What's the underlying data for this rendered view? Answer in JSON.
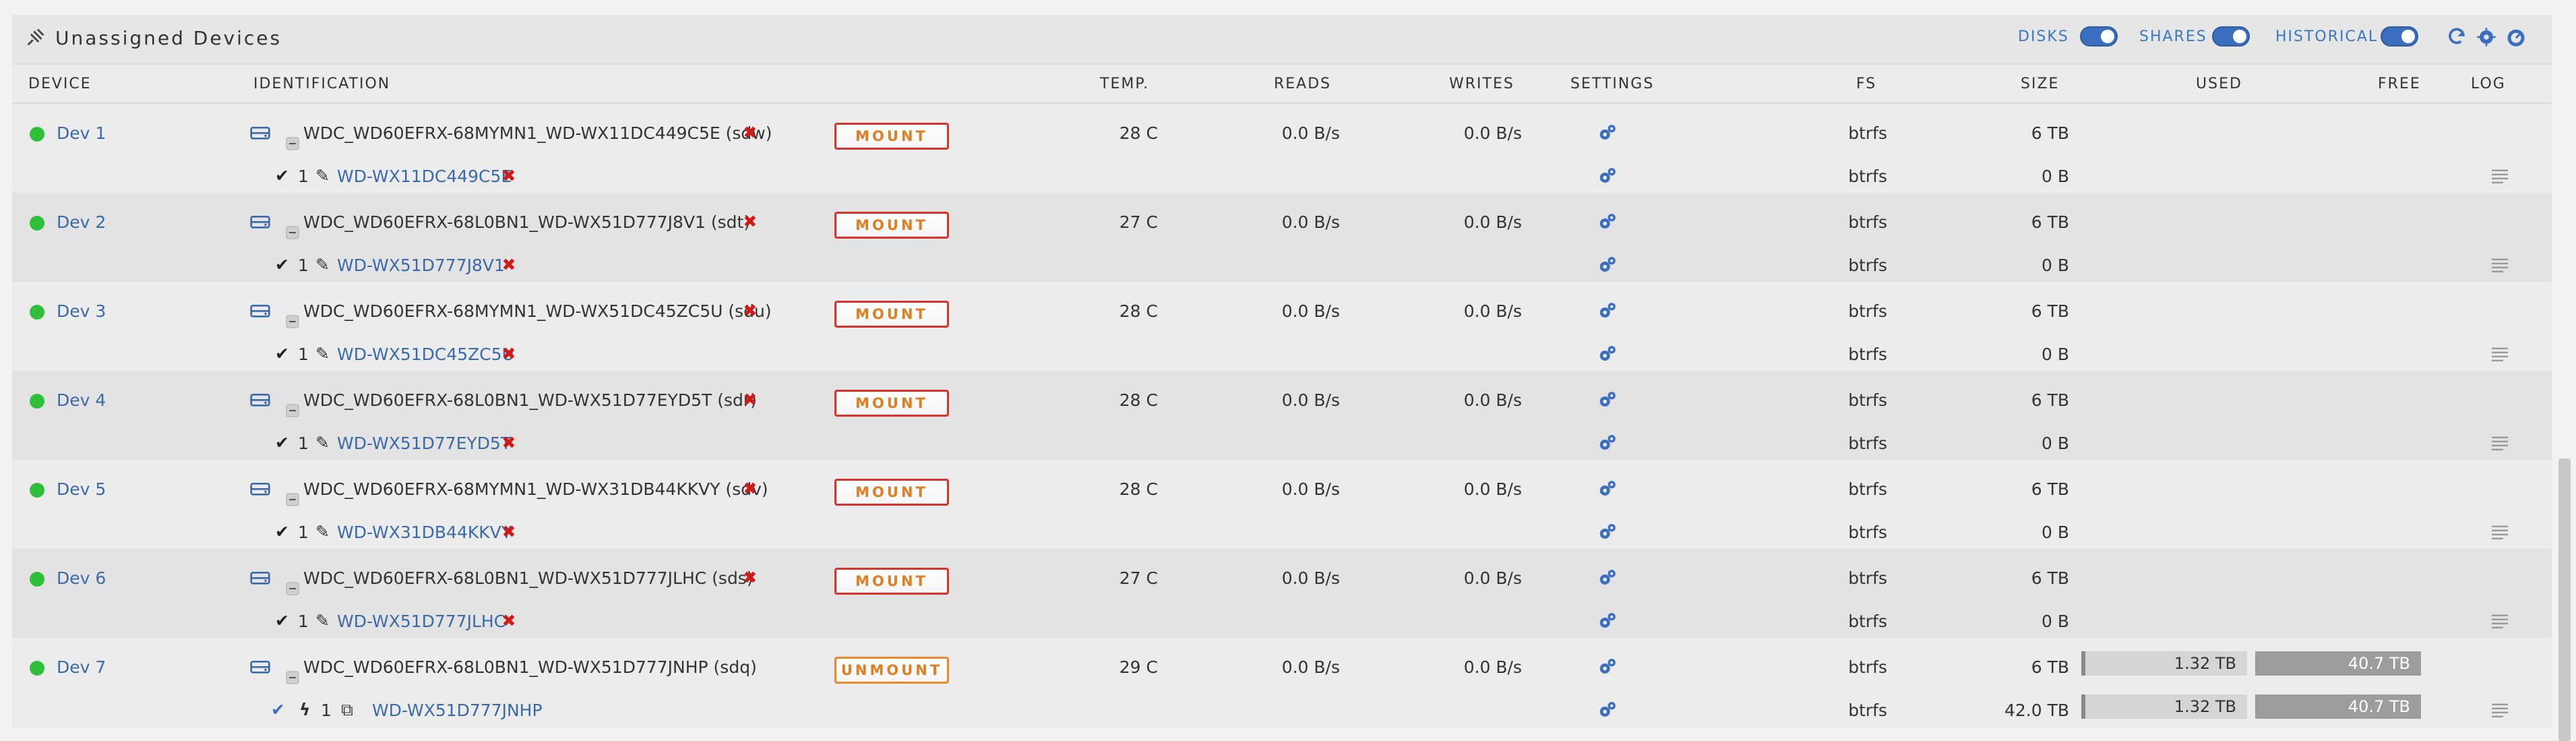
{
  "header": {
    "title": "Unassigned Devices",
    "toggles": [
      {
        "label": "DISKS",
        "on": true
      },
      {
        "label": "SHARES",
        "on": true
      },
      {
        "label": "HISTORICAL",
        "on": true
      }
    ]
  },
  "columns": {
    "device": "DEVICE",
    "identification": "IDENTIFICATION",
    "temp": "TEMP.",
    "reads": "READS",
    "writes": "WRITES",
    "settings": "SETTINGS",
    "fs": "FS",
    "size": "SIZE",
    "used": "USED",
    "free": "FREE",
    "log": "LOG"
  },
  "colors": {
    "accent": "#3a6fc0",
    "status_online": "#2fbf3a",
    "mount": "#e88a2a",
    "remove": "#d11a1a"
  },
  "devices": [
    {
      "name": "Dev 1",
      "id": "WDC_WD60EFRX-68MYMN1_WD-WX11DC449C5E (sdw)",
      "button": "MOUNT",
      "temp": "28 C",
      "reads": "0.0 B/s",
      "writes": "0.0 B/s",
      "fs": "btrfs",
      "size": "6 TB",
      "part": {
        "num": "1",
        "label": "WD-WX11DC449C5E",
        "fs": "btrfs",
        "size": "0 B"
      }
    },
    {
      "name": "Dev 2",
      "id": "WDC_WD60EFRX-68L0BN1_WD-WX51D777J8V1 (sdt)",
      "button": "MOUNT",
      "temp": "27 C",
      "reads": "0.0 B/s",
      "writes": "0.0 B/s",
      "fs": "btrfs",
      "size": "6 TB",
      "part": {
        "num": "1",
        "label": "WD-WX51D777J8V1",
        "fs": "btrfs",
        "size": "0 B"
      }
    },
    {
      "name": "Dev 3",
      "id": "WDC_WD60EFRX-68MYMN1_WD-WX51DC45ZC5U (sdu)",
      "button": "MOUNT",
      "temp": "28 C",
      "reads": "0.0 B/s",
      "writes": "0.0 B/s",
      "fs": "btrfs",
      "size": "6 TB",
      "part": {
        "num": "1",
        "label": "WD-WX51DC45ZC5U",
        "fs": "btrfs",
        "size": "0 B"
      }
    },
    {
      "name": "Dev 4",
      "id": "WDC_WD60EFRX-68L0BN1_WD-WX51D77EYD5T (sdr)",
      "button": "MOUNT",
      "temp": "28 C",
      "reads": "0.0 B/s",
      "writes": "0.0 B/s",
      "fs": "btrfs",
      "size": "6 TB",
      "part": {
        "num": "1",
        "label": "WD-WX51D77EYD5T",
        "fs": "btrfs",
        "size": "0 B"
      }
    },
    {
      "name": "Dev 5",
      "id": "WDC_WD60EFRX-68MYMN1_WD-WX31DB44KKVY (sdv)",
      "button": "MOUNT",
      "temp": "28 C",
      "reads": "0.0 B/s",
      "writes": "0.0 B/s",
      "fs": "btrfs",
      "size": "6 TB",
      "part": {
        "num": "1",
        "label": "WD-WX31DB44KKVY",
        "fs": "btrfs",
        "size": "0 B"
      }
    },
    {
      "name": "Dev 6",
      "id": "WDC_WD60EFRX-68L0BN1_WD-WX51D777JLHC (sds)",
      "button": "MOUNT",
      "temp": "27 C",
      "reads": "0.0 B/s",
      "writes": "0.0 B/s",
      "fs": "btrfs",
      "size": "6 TB",
      "part": {
        "num": "1",
        "label": "WD-WX51D777JLHC",
        "fs": "btrfs",
        "size": "0 B"
      }
    },
    {
      "name": "Dev 7",
      "id": "WDC_WD60EFRX-68L0BN1_WD-WX51D777JNHP (sdq)",
      "button": "UNMOUNT",
      "temp": "29 C",
      "reads": "0.0 B/s",
      "writes": "0.0 B/s",
      "fs": "btrfs",
      "size": "6 TB",
      "used": "1.32 TB",
      "free": "40.7 TB",
      "part": {
        "num": "1",
        "label": "WD-WX51D777JNHP",
        "fs": "btrfs",
        "size": "42.0 TB",
        "used": "1.32 TB",
        "free": "40.7 TB",
        "mounted": true
      }
    }
  ]
}
